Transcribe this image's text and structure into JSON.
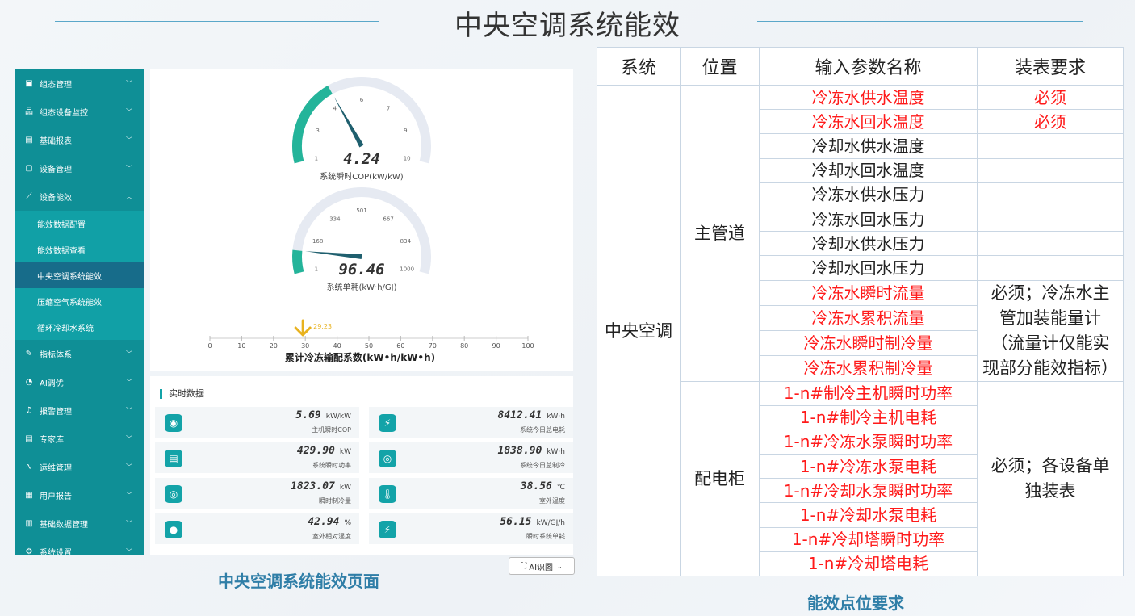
{
  "slide": {
    "title": "中央空调系统能效",
    "left_caption": "中央空调系统能效页面",
    "right_caption": "能效点位要求"
  },
  "sidebar": {
    "items_top": [
      {
        "label": "组态管理",
        "icon": "monitor-icon"
      },
      {
        "label": "组态设备监控",
        "icon": "network-icon"
      },
      {
        "label": "基础报表",
        "icon": "report-icon"
      },
      {
        "label": "设备管理",
        "icon": "device-icon"
      },
      {
        "label": "设备能效",
        "icon": "chart-icon"
      }
    ],
    "sub_items": [
      "能效数据配置",
      "能效数据查看",
      "中央空调系统能效",
      "压缩空气系统能效",
      "循环冷却水系统"
    ],
    "items_bottom": [
      {
        "label": "指标体系",
        "icon": "edit-icon"
      },
      {
        "label": "AI调优",
        "icon": "ai-icon"
      },
      {
        "label": "报警管理",
        "icon": "alarm-icon"
      },
      {
        "label": "专家库",
        "icon": "book-icon"
      },
      {
        "label": "运维管理",
        "icon": "pulse-icon"
      },
      {
        "label": "用户报告",
        "icon": "file-icon"
      },
      {
        "label": "基础数据管理",
        "icon": "database-icon"
      },
      {
        "label": "系统设置",
        "icon": "gear-icon"
      }
    ]
  },
  "gauges": [
    {
      "value": 4.24,
      "display": "4.24",
      "label": "系统瞬时COP(kW/kW)",
      "min": 1,
      "max": 10,
      "ticks": [
        "1",
        "3",
        "4",
        "6",
        "7",
        "9",
        "10"
      ]
    },
    {
      "value": 96.46,
      "display": "96.46",
      "label": "系统单耗(kW·h/GJ)",
      "min": 1,
      "max": 1000,
      "ticks": [
        "1",
        "168",
        "334",
        "501",
        "667",
        "834",
        "1000"
      ]
    }
  ],
  "scale": {
    "title": "累计冷冻输配系数(kW•h/kW•h)",
    "marker_value": 29.23,
    "marker_display": "29.23",
    "min": 0,
    "max": 100,
    "ticks": [
      "0",
      "10",
      "20",
      "30",
      "40",
      "50",
      "60",
      "70",
      "80",
      "90",
      "100"
    ]
  },
  "realtime": {
    "title": "实时数据",
    "cards": [
      {
        "value": "5.69",
        "unit": "kW/kW",
        "label": "主机瞬时COP",
        "icon": "cop-icon"
      },
      {
        "value": "8412.41",
        "unit": "kW·h",
        "label": "系统今日总电耗",
        "icon": "power-icon"
      },
      {
        "value": "429.90",
        "unit": "kW",
        "label": "系统瞬时功率",
        "icon": "meter-icon"
      },
      {
        "value": "1838.90",
        "unit": "kW·h",
        "label": "系统今日总制冷",
        "icon": "cooling-icon"
      },
      {
        "value": "1823.07",
        "unit": "kW",
        "label": "瞬时制冷量",
        "icon": "snowflake-icon"
      },
      {
        "value": "38.56",
        "unit": "℃",
        "label": "室外温度",
        "icon": "thermometer-icon"
      },
      {
        "value": "42.94",
        "unit": "%",
        "label": "室外相对湿度",
        "icon": "droplet-icon"
      },
      {
        "value": "56.15",
        "unit": "kW/GJ/h",
        "label": "瞬时系统单耗",
        "icon": "energy-icon"
      }
    ]
  },
  "ai_button": {
    "label": "AI识图"
  },
  "table": {
    "headers": [
      "系统",
      "位置",
      "输入参数名称",
      "装表要求"
    ],
    "system": "中央空调",
    "groups": [
      {
        "location": "主管道",
        "rows": [
          {
            "name": "冷冻水供水温度",
            "red": true,
            "req": "必须"
          },
          {
            "name": "冷冻水回水温度",
            "red": true,
            "req": "必须"
          },
          {
            "name": "冷却水供水温度",
            "red": false,
            "req": ""
          },
          {
            "name": "冷却水回水温度",
            "red": false,
            "req": ""
          },
          {
            "name": "冷冻水供水压力",
            "red": false,
            "req": ""
          },
          {
            "name": "冷冻水回水压力",
            "red": false,
            "req": ""
          },
          {
            "name": "冷却水供水压力",
            "red": false,
            "req": ""
          },
          {
            "name": "冷却水回水压力",
            "red": false,
            "req": ""
          },
          {
            "name": "冷冻水瞬时流量",
            "red": true
          },
          {
            "name": "冷冻水累积流量",
            "red": true
          },
          {
            "name": "冷冻水瞬时制冷量",
            "red": true
          },
          {
            "name": "冷冻水累积制冷量",
            "red": true
          }
        ],
        "merged_req": [
          "必须；冷冻水主",
          "管加装能量计",
          "（流量计仅能实",
          "现部分能效指标）"
        ]
      },
      {
        "location": "配电柜",
        "rows": [
          {
            "name": "1-n#制冷主机瞬时功率",
            "red": true
          },
          {
            "name": "1-n#制冷主机电耗",
            "red": true
          },
          {
            "name": "1-n#冷冻水泵瞬时功率",
            "red": true
          },
          {
            "name": "1-n#冷冻水泵电耗",
            "red": true
          },
          {
            "name": "1-n#冷却水泵瞬时功率",
            "red": true
          },
          {
            "name": "1-n#冷却水泵电耗",
            "red": true
          },
          {
            "name": "1-n#冷却塔瞬时功率",
            "red": true
          },
          {
            "name": "1-n#冷却塔电耗",
            "red": true
          }
        ],
        "merged_req": [
          "必须；各设备单",
          "独装表"
        ]
      }
    ]
  },
  "colors": {
    "teal": "#13a3a8",
    "sidebar": "#0f8f96",
    "active": "#176c8a",
    "red": "#ff1a1a",
    "caption": "#2f7ea7"
  }
}
